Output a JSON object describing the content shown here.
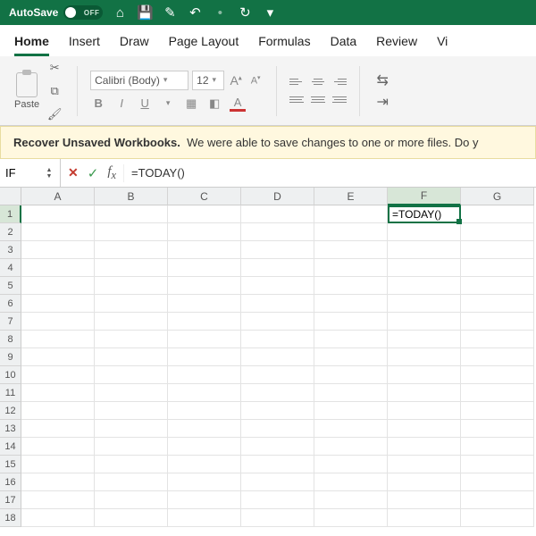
{
  "titlebar": {
    "autosave_label": "AutoSave",
    "autosave_off": "OFF"
  },
  "tabs": [
    "Home",
    "Insert",
    "Draw",
    "Page Layout",
    "Formulas",
    "Data",
    "Review",
    "Vi"
  ],
  "active_tab_index": 0,
  "ribbon": {
    "paste_label": "Paste",
    "font_name": "Calibri (Body)",
    "font_size": "12",
    "formats": {
      "bold": "B",
      "italic": "I",
      "underline": "U"
    }
  },
  "recover": {
    "title": "Recover Unsaved Workbooks.",
    "body": "We were able to save changes to one or more files. Do y"
  },
  "formula_bar": {
    "name_box": "IF",
    "formula": "=TODAY()"
  },
  "grid": {
    "columns": [
      "A",
      "B",
      "C",
      "D",
      "E",
      "F",
      "G"
    ],
    "rows": [
      "1",
      "2",
      "3",
      "4",
      "5",
      "6",
      "7",
      "8",
      "9",
      "10",
      "11",
      "12",
      "13",
      "14",
      "15",
      "16",
      "17",
      "18"
    ],
    "active_col_index": 5,
    "active_row_index": 0,
    "active_cell_value": "=TODAY()"
  }
}
